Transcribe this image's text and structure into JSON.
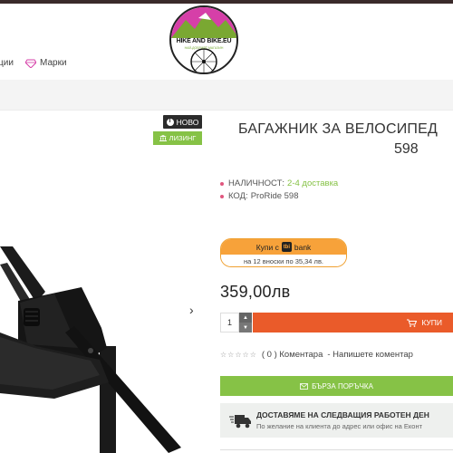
{
  "logo": {
    "title": "HIKE AND BIKE.EU",
    "subtitle": "НАЙ-ДОБРИЯТ МАГАЗИН"
  },
  "nav": {
    "left_partial": "ции",
    "brands": "Марки"
  },
  "badges": {
    "new": "НОВО",
    "leasing": "ЛИЗИНГ"
  },
  "product": {
    "title_line1": "БАГАЖНИК ЗА ВЕЛОСИПЕД",
    "title_line2": "598",
    "availability_label": "НАЛИЧНОСТ:",
    "availability_value": "2-4 доставка",
    "code_label": "КОД:",
    "code_value": "ProRide 598",
    "price": "359,00лв",
    "quantity": "1"
  },
  "bank": {
    "buy_with": "Купи с",
    "logo": "tbi",
    "name": "bank",
    "installments": "на 12 вноски по 35,34 лв."
  },
  "buttons": {
    "buy": "КУПИ",
    "quick_order": "БЪРЗА ПОРЪЧКА",
    "qty_up": "▲",
    "qty_down": "▼"
  },
  "rating": {
    "stars": "☆☆☆☆☆",
    "comments": "( 0 ) Коментара",
    "write": "- Напишете коментар"
  },
  "delivery": {
    "title": "ДОСТАВЯМЕ НА СЛЕДВАЩИЯ РАБОТЕН ДЕН",
    "subtitle": "По желание на клиента до адрес или офис на Еконт"
  },
  "colors": {
    "accent_orange": "#ea5b2a",
    "accent_green": "#86c246",
    "bank_orange": "#f7a23a",
    "dark": "#2b2b2b"
  }
}
